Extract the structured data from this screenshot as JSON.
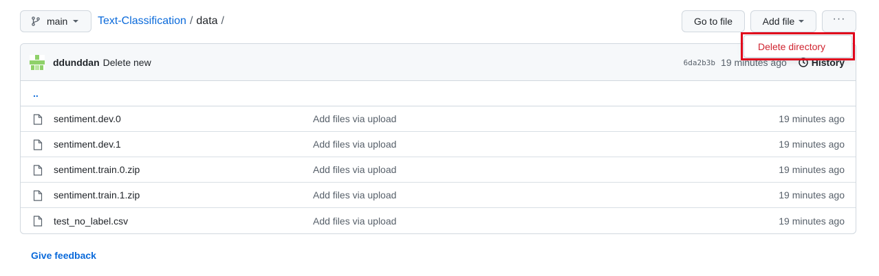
{
  "branch": {
    "name": "main",
    "icon": "git-branch-icon"
  },
  "breadcrumb": {
    "repo": "Text-Classification",
    "sep1": "/",
    "folder": "data",
    "sep2": "/"
  },
  "toolbar": {
    "goto_label": "Go to file",
    "add_file_label": "Add file",
    "more_label": "···"
  },
  "dropdown": {
    "delete_label": "Delete directory",
    "color": "#cf222e"
  },
  "commit": {
    "author": "ddunddan",
    "message": "Delete new",
    "sha": "6da2b3b",
    "time": "19 minutes ago",
    "history_label": "History"
  },
  "up_label": "..",
  "files": [
    {
      "name": "sentiment.dev.0",
      "message": "Add files via upload",
      "age": "19 minutes ago"
    },
    {
      "name": "sentiment.dev.1",
      "message": "Add files via upload",
      "age": "19 minutes ago"
    },
    {
      "name": "sentiment.train.0.zip",
      "message": "Add files via upload",
      "age": "19 minutes ago"
    },
    {
      "name": "sentiment.train.1.zip",
      "message": "Add files via upload",
      "age": "19 minutes ago"
    },
    {
      "name": "test_no_label.csv",
      "message": "Add files via upload",
      "age": "19 minutes ago"
    }
  ],
  "footer": {
    "feedback_label": "Give feedback"
  },
  "colors": {
    "link": "#0969da",
    "border": "#d0d7de",
    "highlight": "#e0001a"
  }
}
